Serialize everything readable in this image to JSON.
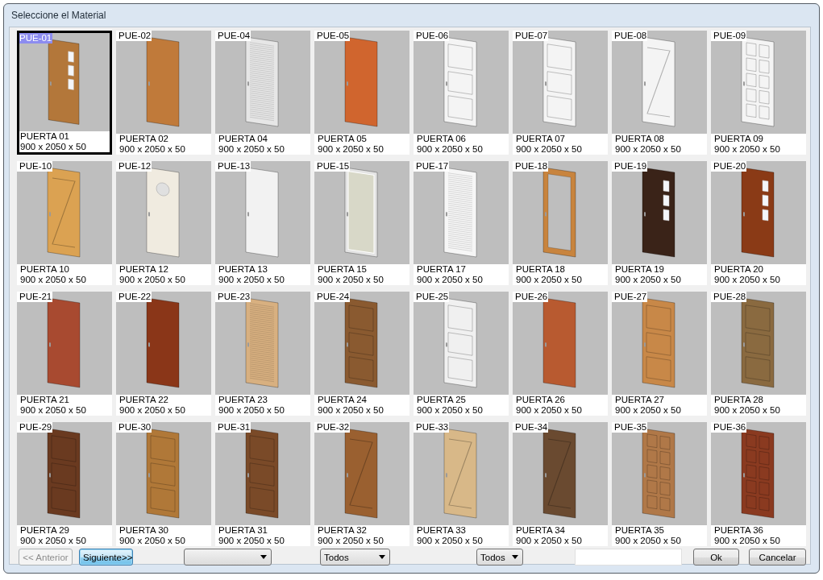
{
  "window": {
    "title": "Seleccione el Material"
  },
  "doors": [
    {
      "code": "PUE-01",
      "name": "PUERTA 01",
      "size": "900 x 2050 x 50",
      "color": "#b3773a",
      "kind": "windows",
      "selected": true
    },
    {
      "code": "PUE-02",
      "name": "PUERTA 02",
      "size": "900 x 2050 x 50",
      "color": "#c07a3a",
      "kind": "plain",
      "selected": false
    },
    {
      "code": "PUE-04",
      "name": "PUERTA 04",
      "size": "900 x 2050 x 50",
      "color": "#e6e6e6",
      "kind": "louver",
      "selected": false
    },
    {
      "code": "PUE-05",
      "name": "PUERTA 05",
      "size": "900 x 2050 x 50",
      "color": "#d0652e",
      "kind": "plain",
      "selected": false
    },
    {
      "code": "PUE-06",
      "name": "PUERTA 06",
      "size": "900 x 2050 x 50",
      "color": "#f4f4f4",
      "kind": "panels",
      "selected": false
    },
    {
      "code": "PUE-07",
      "name": "PUERTA 07",
      "size": "900 x 2050 x 50",
      "color": "#f4f4f4",
      "kind": "panels",
      "selected": false
    },
    {
      "code": "PUE-08",
      "name": "PUERTA 08",
      "size": "900 x 2050 x 50",
      "color": "#f4f4f4",
      "kind": "diagonal",
      "selected": false
    },
    {
      "code": "PUE-09",
      "name": "PUERTA 09",
      "size": "900 x 2050 x 50",
      "color": "#f4f4f4",
      "kind": "grid",
      "selected": false
    },
    {
      "code": "PUE-10",
      "name": "PUERTA 10",
      "size": "900 x 2050 x 50",
      "color": "#dba252",
      "kind": "diagonal",
      "selected": false
    },
    {
      "code": "PUE-12",
      "name": "PUERTA 12",
      "size": "900 x 2050 x 50",
      "color": "#f0ebe0",
      "kind": "porthole",
      "selected": false
    },
    {
      "code": "PUE-13",
      "name": "PUERTA 13",
      "size": "900 x 2050 x 50",
      "color": "#f2f2f2",
      "kind": "plain",
      "selected": false
    },
    {
      "code": "PUE-15",
      "name": "PUERTA 15",
      "size": "900 x 2050 x 50",
      "color": "#e4e4e4",
      "kind": "glass",
      "selected": false
    },
    {
      "code": "PUE-17",
      "name": "PUERTA 17",
      "size": "900 x 2050 x 50",
      "color": "#f6f6f6",
      "kind": "louver",
      "selected": false
    },
    {
      "code": "PUE-18",
      "name": "PUERTA 18",
      "size": "900 x 2050 x 50",
      "color": "#c8843e",
      "kind": "frame",
      "selected": false
    },
    {
      "code": "PUE-19",
      "name": "PUERTA 19",
      "size": "900 x 2050 x 50",
      "color": "#3a2318",
      "kind": "windows",
      "selected": false
    },
    {
      "code": "PUE-20",
      "name": "PUERTA 20",
      "size": "900 x 2050 x 50",
      "color": "#8a3a16",
      "kind": "windows",
      "selected": false
    },
    {
      "code": "PUE-21",
      "name": "PUERTA 21",
      "size": "900 x 2050 x 50",
      "color": "#a84a30",
      "kind": "plain",
      "selected": false
    },
    {
      "code": "PUE-22",
      "name": "PUERTA 22",
      "size": "900 x 2050 x 50",
      "color": "#8a3618",
      "kind": "plain",
      "selected": false
    },
    {
      "code": "PUE-23",
      "name": "PUERTA 23",
      "size": "900 x 2050 x 50",
      "color": "#d8b080",
      "kind": "louver",
      "selected": false
    },
    {
      "code": "PUE-24",
      "name": "PUERTA 24",
      "size": "900 x 2050 x 50",
      "color": "#8a5a30",
      "kind": "panels",
      "selected": false
    },
    {
      "code": "PUE-25",
      "name": "PUERTA 25",
      "size": "900 x 2050 x 50",
      "color": "#f0f0f0",
      "kind": "panels",
      "selected": false
    },
    {
      "code": "PUE-26",
      "name": "PUERTA 26",
      "size": "900 x 2050 x 50",
      "color": "#b85a30",
      "kind": "plain",
      "selected": false
    },
    {
      "code": "PUE-27",
      "name": "PUERTA 27",
      "size": "900 x 2050 x 50",
      "color": "#c88848",
      "kind": "panels",
      "selected": false
    },
    {
      "code": "PUE-28",
      "name": "PUERTA 28",
      "size": "900 x 2050 x 50",
      "color": "#8a6a40",
      "kind": "panels",
      "selected": false
    },
    {
      "code": "PUE-29",
      "name": "PUERTA 29",
      "size": "900 x 2050 x 50",
      "color": "#6a3a20",
      "kind": "panels",
      "selected": false
    },
    {
      "code": "PUE-30",
      "name": "PUERTA 30",
      "size": "900 x 2050 x 50",
      "color": "#b07838",
      "kind": "panels",
      "selected": false
    },
    {
      "code": "PUE-31",
      "name": "PUERTA 31",
      "size": "900 x 2050 x 50",
      "color": "#7a4a28",
      "kind": "panels",
      "selected": false
    },
    {
      "code": "PUE-32",
      "name": "PUERTA 32",
      "size": "900 x 2050 x 50",
      "color": "#9a6030",
      "kind": "diagonal",
      "selected": false
    },
    {
      "code": "PUE-33",
      "name": "PUERTA 33",
      "size": "900 x 2050 x 50",
      "color": "#d8b888",
      "kind": "diagonal",
      "selected": false
    },
    {
      "code": "PUE-34",
      "name": "PUERTA 34",
      "size": "900 x 2050 x 50",
      "color": "#6a4a30",
      "kind": "diagonal",
      "selected": false
    },
    {
      "code": "PUE-35",
      "name": "PUERTA 35",
      "size": "900 x 2050 x 50",
      "color": "#b07848",
      "kind": "grid",
      "selected": false
    },
    {
      "code": "PUE-36",
      "name": "PUERTA 36",
      "size": "900 x 2050 x 50",
      "color": "#8a3a20",
      "kind": "grid",
      "selected": false
    }
  ],
  "pager": [
    {
      "label": "<< Anterior",
      "disabled": true,
      "focused": false
    },
    {
      "label": "Siguiente>>",
      "disabled": false,
      "focused": true
    }
  ],
  "dropdowns": [
    {
      "kind": "empty"
    },
    {
      "kind": "text",
      "value": "Todos"
    },
    {
      "kind": "text",
      "value": "Todos"
    }
  ],
  "actions": [
    {
      "label": "Ok"
    },
    {
      "label": "Cancelar"
    }
  ]
}
